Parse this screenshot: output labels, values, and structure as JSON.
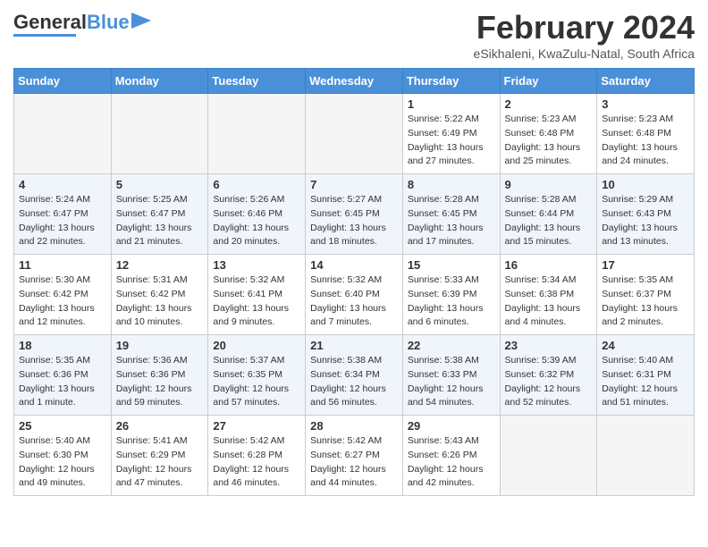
{
  "header": {
    "logo_general": "General",
    "logo_blue": "Blue",
    "month_title": "February 2024",
    "location": "eSikhaleni, KwaZulu-Natal, South Africa"
  },
  "weekdays": [
    "Sunday",
    "Monday",
    "Tuesday",
    "Wednesday",
    "Thursday",
    "Friday",
    "Saturday"
  ],
  "weeks": [
    [
      {
        "day": "",
        "info": "",
        "empty": true
      },
      {
        "day": "",
        "info": "",
        "empty": true
      },
      {
        "day": "",
        "info": "",
        "empty": true
      },
      {
        "day": "",
        "info": "",
        "empty": true
      },
      {
        "day": "1",
        "info": "Sunrise: 5:22 AM\nSunset: 6:49 PM\nDaylight: 13 hours\nand 27 minutes."
      },
      {
        "day": "2",
        "info": "Sunrise: 5:23 AM\nSunset: 6:48 PM\nDaylight: 13 hours\nand 25 minutes."
      },
      {
        "day": "3",
        "info": "Sunrise: 5:23 AM\nSunset: 6:48 PM\nDaylight: 13 hours\nand 24 minutes."
      }
    ],
    [
      {
        "day": "4",
        "info": "Sunrise: 5:24 AM\nSunset: 6:47 PM\nDaylight: 13 hours\nand 22 minutes."
      },
      {
        "day": "5",
        "info": "Sunrise: 5:25 AM\nSunset: 6:47 PM\nDaylight: 13 hours\nand 21 minutes."
      },
      {
        "day": "6",
        "info": "Sunrise: 5:26 AM\nSunset: 6:46 PM\nDaylight: 13 hours\nand 20 minutes."
      },
      {
        "day": "7",
        "info": "Sunrise: 5:27 AM\nSunset: 6:45 PM\nDaylight: 13 hours\nand 18 minutes."
      },
      {
        "day": "8",
        "info": "Sunrise: 5:28 AM\nSunset: 6:45 PM\nDaylight: 13 hours\nand 17 minutes."
      },
      {
        "day": "9",
        "info": "Sunrise: 5:28 AM\nSunset: 6:44 PM\nDaylight: 13 hours\nand 15 minutes."
      },
      {
        "day": "10",
        "info": "Sunrise: 5:29 AM\nSunset: 6:43 PM\nDaylight: 13 hours\nand 13 minutes."
      }
    ],
    [
      {
        "day": "11",
        "info": "Sunrise: 5:30 AM\nSunset: 6:42 PM\nDaylight: 13 hours\nand 12 minutes."
      },
      {
        "day": "12",
        "info": "Sunrise: 5:31 AM\nSunset: 6:42 PM\nDaylight: 13 hours\nand 10 minutes."
      },
      {
        "day": "13",
        "info": "Sunrise: 5:32 AM\nSunset: 6:41 PM\nDaylight: 13 hours\nand 9 minutes."
      },
      {
        "day": "14",
        "info": "Sunrise: 5:32 AM\nSunset: 6:40 PM\nDaylight: 13 hours\nand 7 minutes."
      },
      {
        "day": "15",
        "info": "Sunrise: 5:33 AM\nSunset: 6:39 PM\nDaylight: 13 hours\nand 6 minutes."
      },
      {
        "day": "16",
        "info": "Sunrise: 5:34 AM\nSunset: 6:38 PM\nDaylight: 13 hours\nand 4 minutes."
      },
      {
        "day": "17",
        "info": "Sunrise: 5:35 AM\nSunset: 6:37 PM\nDaylight: 13 hours\nand 2 minutes."
      }
    ],
    [
      {
        "day": "18",
        "info": "Sunrise: 5:35 AM\nSunset: 6:36 PM\nDaylight: 13 hours\nand 1 minute."
      },
      {
        "day": "19",
        "info": "Sunrise: 5:36 AM\nSunset: 6:36 PM\nDaylight: 12 hours\nand 59 minutes."
      },
      {
        "day": "20",
        "info": "Sunrise: 5:37 AM\nSunset: 6:35 PM\nDaylight: 12 hours\nand 57 minutes."
      },
      {
        "day": "21",
        "info": "Sunrise: 5:38 AM\nSunset: 6:34 PM\nDaylight: 12 hours\nand 56 minutes."
      },
      {
        "day": "22",
        "info": "Sunrise: 5:38 AM\nSunset: 6:33 PM\nDaylight: 12 hours\nand 54 minutes."
      },
      {
        "day": "23",
        "info": "Sunrise: 5:39 AM\nSunset: 6:32 PM\nDaylight: 12 hours\nand 52 minutes."
      },
      {
        "day": "24",
        "info": "Sunrise: 5:40 AM\nSunset: 6:31 PM\nDaylight: 12 hours\nand 51 minutes."
      }
    ],
    [
      {
        "day": "25",
        "info": "Sunrise: 5:40 AM\nSunset: 6:30 PM\nDaylight: 12 hours\nand 49 minutes."
      },
      {
        "day": "26",
        "info": "Sunrise: 5:41 AM\nSunset: 6:29 PM\nDaylight: 12 hours\nand 47 minutes."
      },
      {
        "day": "27",
        "info": "Sunrise: 5:42 AM\nSunset: 6:28 PM\nDaylight: 12 hours\nand 46 minutes."
      },
      {
        "day": "28",
        "info": "Sunrise: 5:42 AM\nSunset: 6:27 PM\nDaylight: 12 hours\nand 44 minutes."
      },
      {
        "day": "29",
        "info": "Sunrise: 5:43 AM\nSunset: 6:26 PM\nDaylight: 12 hours\nand 42 minutes."
      },
      {
        "day": "",
        "info": "",
        "empty": true
      },
      {
        "day": "",
        "info": "",
        "empty": true
      }
    ]
  ]
}
